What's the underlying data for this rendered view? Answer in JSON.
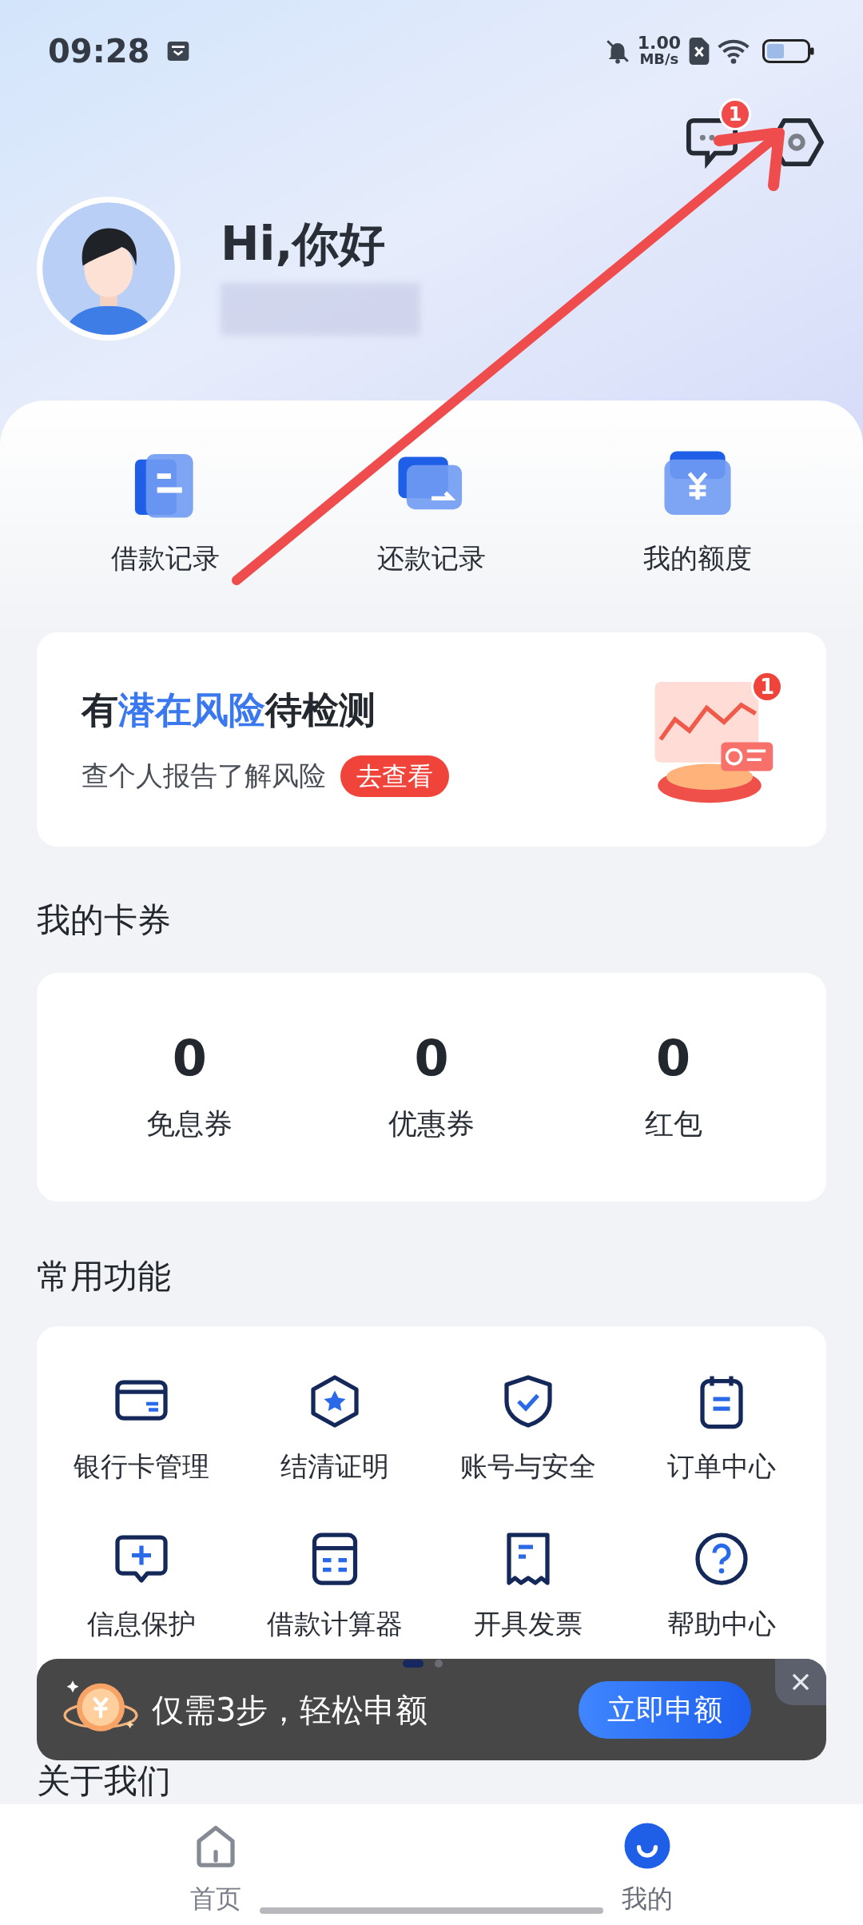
{
  "status_bar": {
    "time": "09:28",
    "net_speed_value": "1.00",
    "net_speed_unit": "MB/s"
  },
  "header": {
    "message_badge": "1",
    "greeting": "Hi,你好"
  },
  "quick_links": [
    {
      "kind": "loan",
      "label": "借款记录"
    },
    {
      "kind": "repay",
      "label": "还款记录"
    },
    {
      "kind": "quota",
      "label": "我的额度"
    }
  ],
  "risk_card": {
    "title_prefix": "有",
    "title_highlight": "潜在风险",
    "title_suffix": "待检测",
    "subtitle": "查个人报告了解风险",
    "button": "去查看",
    "badge": "1"
  },
  "coupons": {
    "title": "我的卡券",
    "items": [
      {
        "value": "0",
        "label": "免息券"
      },
      {
        "value": "0",
        "label": "优惠券"
      },
      {
        "value": "0",
        "label": "红包"
      }
    ]
  },
  "functions": {
    "title": "常用功能",
    "items": [
      {
        "kind": "card",
        "label": "银行卡管理"
      },
      {
        "kind": "badge",
        "label": "结清证明"
      },
      {
        "kind": "shield",
        "label": "账号与安全"
      },
      {
        "kind": "order",
        "label": "订单中心"
      },
      {
        "kind": "message",
        "label": "信息保护"
      },
      {
        "kind": "calculator",
        "label": "借款计算器"
      },
      {
        "kind": "receipt",
        "label": "开具发票"
      },
      {
        "kind": "help",
        "label": "帮助中心"
      }
    ],
    "pages": [
      {
        "selected": true
      },
      {
        "selected": false
      }
    ]
  },
  "promo": {
    "text": "仅需3步，轻松申额",
    "button": "立即申额"
  },
  "about": {
    "title": "关于我们"
  },
  "bottom_nav": [
    {
      "kind": "home",
      "label": "首页",
      "selected": false
    },
    {
      "kind": "me",
      "label": "我的",
      "selected": true
    }
  ]
}
